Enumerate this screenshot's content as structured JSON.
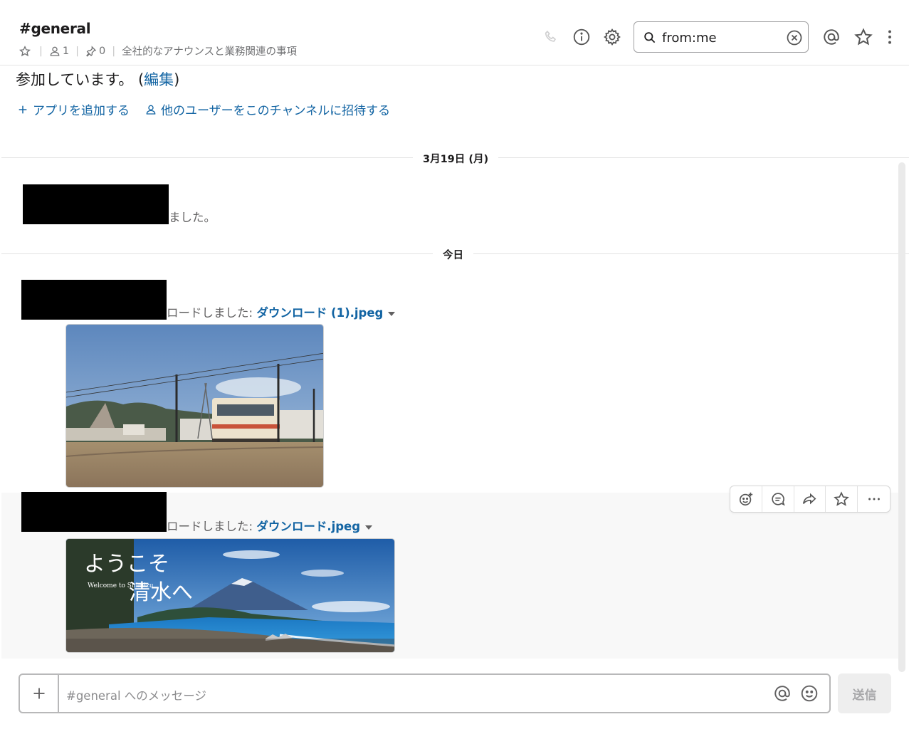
{
  "header": {
    "channel_name": "#general",
    "member_count": "1",
    "pinned_count": "0",
    "topic": "全社的なアナウンスと業務関連の事項",
    "search_value": "from:me"
  },
  "intro": {
    "text": "参加しています。 (",
    "edit_link": "編集",
    "text_end": ")",
    "add_app": "アプリを追加する",
    "invite_users": "他のユーザーをこのチャンネルに招待する"
  },
  "dividers": {
    "first": "3月19日 (月)",
    "second": "今日"
  },
  "messages": [
    {
      "text": "ました。"
    },
    {
      "text": "ロードしました: ",
      "file": "ダウンロード (1).jpeg"
    },
    {
      "text": "ロードしました: ",
      "file": "ダウンロード.jpeg"
    }
  ],
  "images": {
    "welcome_banner": {
      "title": "ようこそ",
      "title_2": "清水へ",
      "subtitle": "Welcome to Shimizu"
    }
  },
  "composer": {
    "placeholder": "#general へのメッセージ",
    "send_label": "送信"
  },
  "colors": {
    "link": "#1264a3",
    "text": "#1d1c1d",
    "muted": "#616061"
  }
}
